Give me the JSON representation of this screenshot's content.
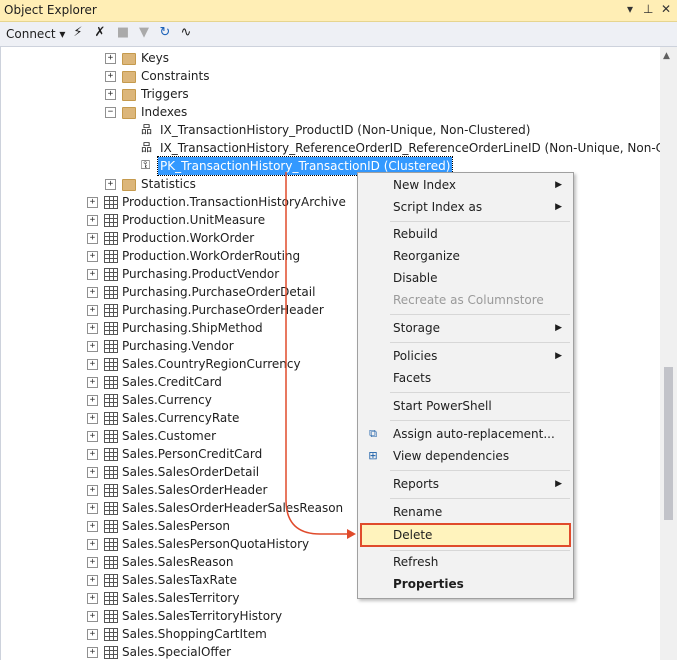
{
  "window": {
    "title": "Object Explorer"
  },
  "toolbar": {
    "connect_label": "Connect ▾"
  },
  "tree": {
    "sub_items": [
      {
        "label": "Keys",
        "expanded": false
      },
      {
        "label": "Constraints",
        "expanded": false
      },
      {
        "label": "Triggers",
        "expanded": false
      },
      {
        "label": "Indexes",
        "expanded": true
      }
    ],
    "indexes": [
      "IX_TransactionHistory_ProductID (Non-Unique, Non-Clustered)",
      "IX_TransactionHistory_ReferenceOrderID_ReferenceOrderLineID (Non-Unique, Non-Clustered)",
      "PK_TransactionHistory_TransactionID (Clustered)"
    ],
    "statistics_label": "Statistics",
    "tables": [
      "Production.TransactionHistoryArchive",
      "Production.UnitMeasure",
      "Production.WorkOrder",
      "Production.WorkOrderRouting",
      "Purchasing.ProductVendor",
      "Purchasing.PurchaseOrderDetail",
      "Purchasing.PurchaseOrderHeader",
      "Purchasing.ShipMethod",
      "Purchasing.Vendor",
      "Sales.CountryRegionCurrency",
      "Sales.CreditCard",
      "Sales.Currency",
      "Sales.CurrencyRate",
      "Sales.Customer",
      "Sales.PersonCreditCard",
      "Sales.SalesOrderDetail",
      "Sales.SalesOrderHeader",
      "Sales.SalesOrderHeaderSalesReason",
      "Sales.SalesPerson",
      "Sales.SalesPersonQuotaHistory",
      "Sales.SalesReason",
      "Sales.SalesTaxRate",
      "Sales.SalesTerritory",
      "Sales.SalesTerritoryHistory",
      "Sales.ShoppingCartItem",
      "Sales.SpecialOffer"
    ]
  },
  "context_menu": {
    "new_index": "New Index",
    "script_index_as": "Script Index as",
    "rebuild": "Rebuild",
    "reorganize": "Reorganize",
    "disable": "Disable",
    "recreate_columnstore": "Recreate as Columnstore",
    "storage": "Storage",
    "policies": "Policies",
    "facets": "Facets",
    "start_powershell": "Start PowerShell",
    "assign_auto_replacement": "Assign auto-replacement...",
    "view_dependencies": "View dependencies",
    "reports": "Reports",
    "rename": "Rename",
    "delete": "Delete",
    "refresh": "Refresh",
    "properties": "Properties"
  },
  "colors": {
    "highlight_border": "#e04b2c",
    "highlight_fill": "#fff3bd",
    "selection": "#3399ff",
    "titlebar": "#ffeeb5"
  }
}
